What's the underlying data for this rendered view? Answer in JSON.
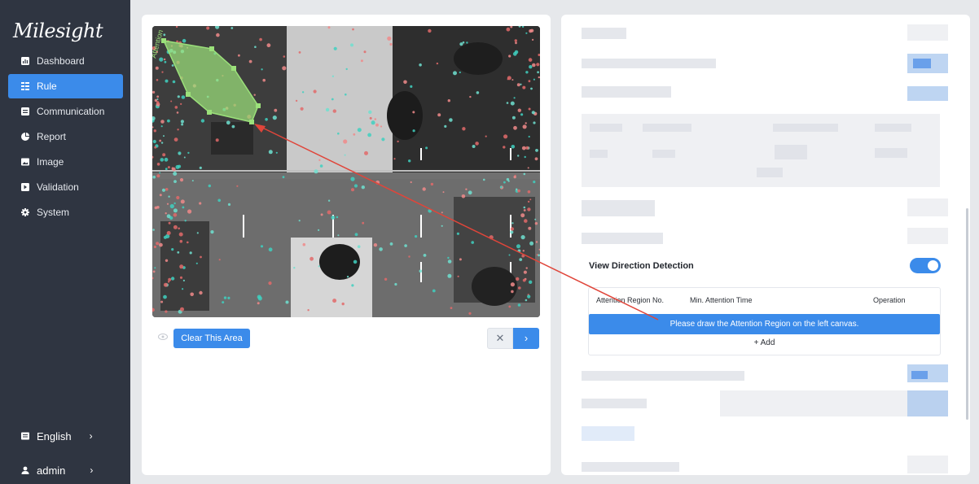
{
  "sidebar": {
    "logo": "Milesight",
    "items": [
      {
        "label": "Dashboard",
        "icon": "dashboard-icon",
        "active": false
      },
      {
        "label": "Rule",
        "icon": "rule-icon",
        "active": true
      },
      {
        "label": "Communication",
        "icon": "communication-icon",
        "active": false
      },
      {
        "label": "Report",
        "icon": "report-icon",
        "active": false
      },
      {
        "label": "Image",
        "icon": "image-icon",
        "active": false
      },
      {
        "label": "Validation",
        "icon": "validation-icon",
        "active": false
      },
      {
        "label": "System",
        "icon": "system-icon",
        "active": false
      }
    ],
    "language": {
      "label": "English",
      "icon": "language-icon",
      "chevron": "›"
    },
    "user": {
      "label": "admin",
      "icon": "user-icon",
      "chevron": "›"
    }
  },
  "canvas": {
    "region_label": "Attention",
    "clear_button": "Clear This Area",
    "cancel_glyph": "✕",
    "next_glyph": "›"
  },
  "view_direction": {
    "label": "View Direction Detection",
    "enabled": true,
    "columns": [
      "Attention Region No.",
      "Min. Attention Time",
      "Operation"
    ],
    "hint": "Please draw the Attention Region on the left canvas.",
    "add_label": "+ Add"
  },
  "colors": {
    "accent": "#3b8bea",
    "sidebar_bg": "#2f3541",
    "region_fill": "#9be07a",
    "arrow": "#e0453a"
  }
}
